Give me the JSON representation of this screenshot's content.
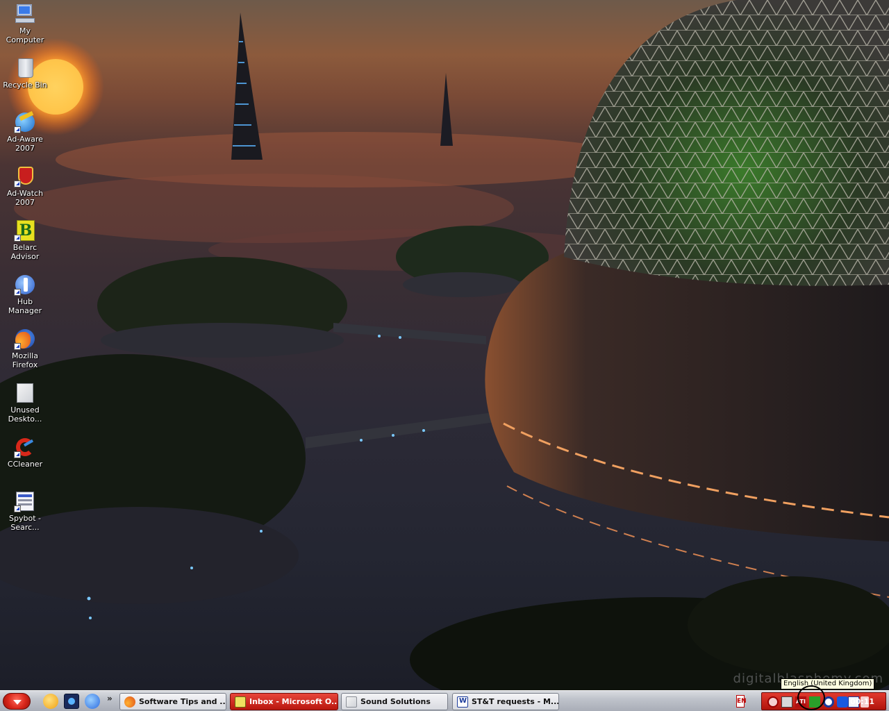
{
  "desktop": {
    "icons": [
      {
        "label": "My Computer",
        "icon": "my-computer-icon"
      },
      {
        "label": "Recycle Bin",
        "icon": "recycle-bin-icon"
      },
      {
        "label": "Ad-Aware 2007",
        "icon": "ad-aware-icon"
      },
      {
        "label": "Ad-Watch 2007",
        "icon": "ad-watch-icon"
      },
      {
        "label": "Belarc Advisor",
        "icon": "belarc-advisor-icon"
      },
      {
        "label": "Hub Manager",
        "icon": "hub-manager-icon"
      },
      {
        "label": "Mozilla Firefox",
        "icon": "firefox-icon"
      },
      {
        "label": "Unused Deskto...",
        "icon": "folder-icon"
      },
      {
        "label": "CCleaner",
        "icon": "ccleaner-icon"
      },
      {
        "label": "Spybot - Searc...",
        "icon": "spybot-icon"
      }
    ],
    "watermark": "digitalblasphemy.com"
  },
  "taskbar": {
    "quick_launch": [
      "messenger-icon",
      "media-icon",
      "internet-explorer-icon"
    ],
    "more": "»",
    "tasks": [
      {
        "label": "Software Tips and ...",
        "icon": "firefox-icon",
        "active": false
      },
      {
        "label": "Inbox - Microsoft O...",
        "icon": "outlook-icon",
        "active": true
      },
      {
        "label": "Sound Solutions",
        "icon": "folder-icon",
        "active": false
      },
      {
        "label": "ST&T requests - M...",
        "icon": "word-icon",
        "active": false
      }
    ],
    "language_indicator": "EN",
    "tooltip": "English (United Kingdom)",
    "clock": "00:11",
    "tray_icons": [
      "antivirus-icon",
      "network-icon",
      "ati-icon",
      "volume-icon",
      "language-bar-icon",
      "bluetooth-icon",
      "mail-icon",
      "security-icon"
    ]
  },
  "colors": {
    "taskbar_active": "#c81e14",
    "tray": "#c81e14"
  }
}
